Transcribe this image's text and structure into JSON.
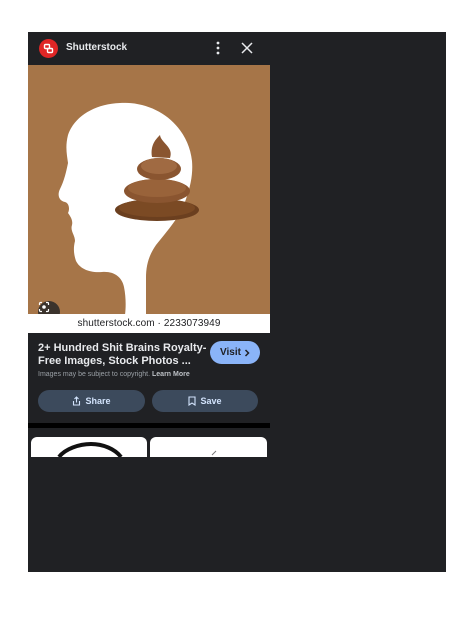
{
  "header": {
    "site_name": "Shutterstock",
    "logo_icon": "shutterstock-logo-icon",
    "more_icon": "more-vert-icon",
    "close_icon": "close-icon"
  },
  "image": {
    "watermark": "shutterstock.com · 2233073949",
    "lens_icon": "google-lens-icon"
  },
  "result": {
    "title": "2+ Hundred Shit Brains Royalty-Free Images, Stock Photos ...",
    "visit_label": "Visit",
    "copyright_text": "Images may be subject to copyright.",
    "learn_more": "Learn More"
  },
  "actions": {
    "share_label": "Share",
    "save_label": "Save"
  },
  "colors": {
    "background": "#202124",
    "accent": "#8ab4f8",
    "button": "#3c4a5c",
    "image_bg": "#a67548"
  }
}
